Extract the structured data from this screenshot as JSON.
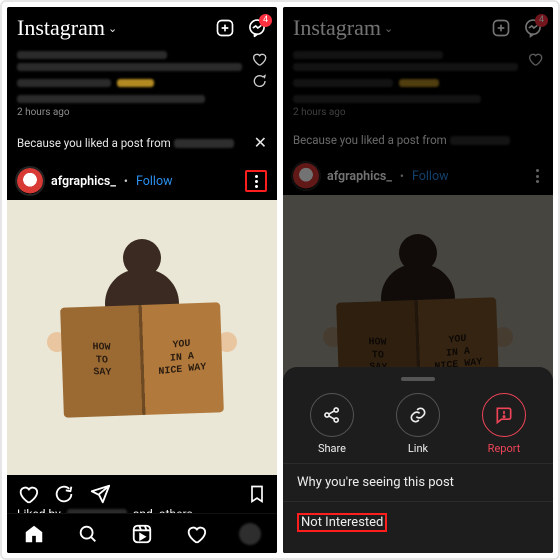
{
  "header": {
    "logo_text": "Instagram",
    "dm_badge": "4"
  },
  "prev_post": {
    "timestamp": "2 hours ago"
  },
  "suggest": {
    "prefix": "Because you liked a post from "
  },
  "post": {
    "username": "afgraphics_",
    "separator": "•",
    "follow_label": "Follow",
    "book_left": "HOW\nTO\nSAY",
    "book_right": "YOU\nIN A\nNICE WAY"
  },
  "below": {
    "liked_prefix": "Liked by",
    "and_label": "and",
    "others_label": "others"
  },
  "sheet": {
    "share": "Share",
    "link": "Link",
    "report": "Report",
    "why": "Why you're seeing this post",
    "not_interested": "Not Interested"
  }
}
